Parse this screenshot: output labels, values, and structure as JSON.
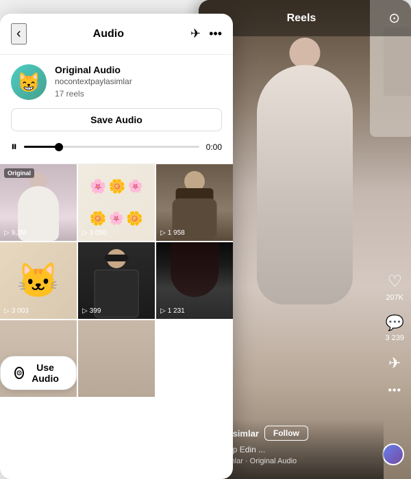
{
  "reels": {
    "title": "Reels",
    "back_icon": "‹",
    "camera_icon": "⊙",
    "video_bg": "person_white_outfit",
    "actions": {
      "like": {
        "icon": "♡",
        "count": "207K"
      },
      "comment": {
        "icon": "💬",
        "count": "3 239"
      },
      "share": {
        "icon": "✈",
        "count": ""
      },
      "more": {
        "icon": "···"
      }
    },
    "user": {
      "username": "tpaylasimlar",
      "follow_label": "Follow",
      "caption": "ler Takip Edin ...",
      "audio": "ylasimlar · Original Audio"
    }
  },
  "audio": {
    "header": {
      "title": "Audio",
      "back_icon": "‹",
      "send_icon": "✈",
      "more_icon": "···"
    },
    "profile": {
      "avatar_emoji": "😸",
      "name": "Original Audio",
      "username": "nocontextpaylasimlar",
      "reels_count": "17 reels"
    },
    "save_button_label": "Save Audio",
    "player": {
      "pause_icon": "⏸",
      "time": "0:00"
    },
    "grid": [
      {
        "id": 1,
        "label": "Original",
        "views": "9,3M",
        "bg": "girl_white"
      },
      {
        "id": 2,
        "label": "",
        "views": "3 050",
        "bg": "flowers"
      },
      {
        "id": 3,
        "label": "",
        "views": "1 958",
        "bg": "man_beard"
      },
      {
        "id": 4,
        "label": "",
        "views": "3 003",
        "bg": "cat"
      },
      {
        "id": 5,
        "label": "",
        "views": "399",
        "bg": "man_suit"
      },
      {
        "id": 6,
        "label": "",
        "views": "1 231",
        "bg": "dark_hair"
      },
      {
        "id": 7,
        "label": "",
        "views": "",
        "bg": "girl2"
      },
      {
        "id": 8,
        "label": "",
        "views": "",
        "bg": "girl3"
      }
    ],
    "use_audio_label": "Use Audio"
  }
}
